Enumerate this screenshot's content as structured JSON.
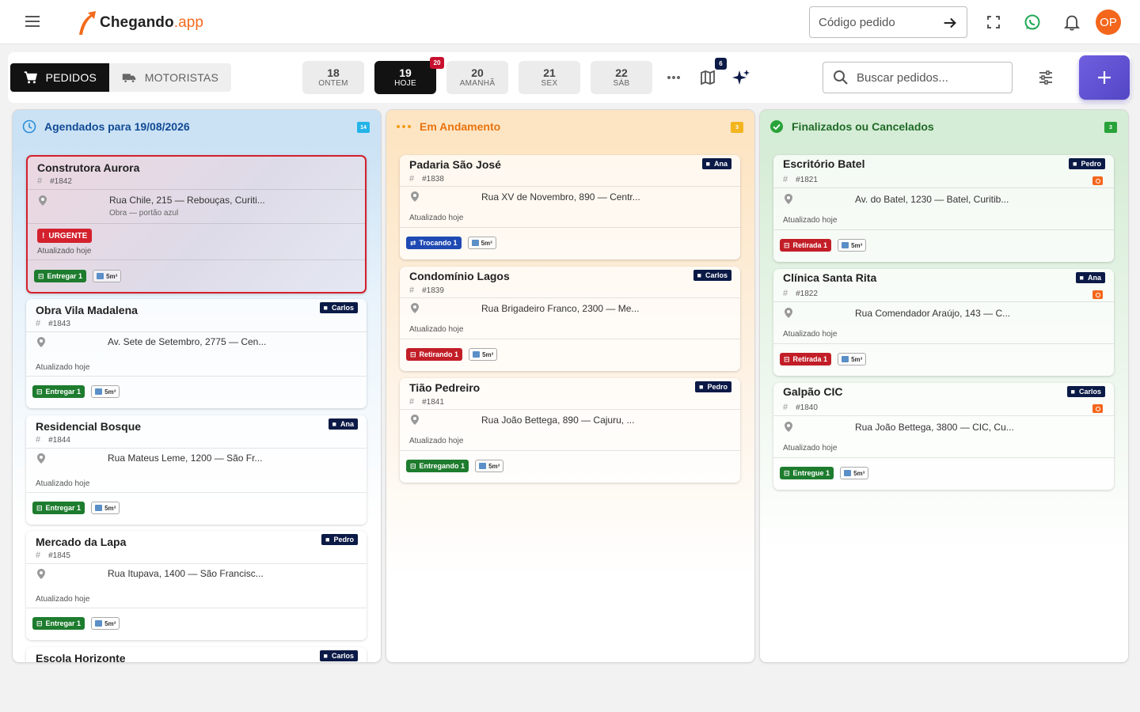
{
  "header": {
    "logo_main": "Chegando",
    "logo_suffix": ".app",
    "code_placeholder": "Código pedido",
    "avatar_initials": "OP"
  },
  "toolbar": {
    "tab_orders": "PEDIDOS",
    "tab_drivers": "MOTORISTAS",
    "dates": [
      {
        "day": "18",
        "label": "ONTEM"
      },
      {
        "day": "19",
        "label": "HOJE",
        "badge": "20"
      },
      {
        "day": "20",
        "label": "AMANHÃ"
      },
      {
        "day": "21",
        "label": "SEX"
      },
      {
        "day": "22",
        "label": "SÁB"
      }
    ],
    "map_badge": "6",
    "search_placeholder": "Buscar pedidos..."
  },
  "colors": {
    "accent": "#f4661b",
    "agendados": "#114a94",
    "andamento": "#e8730f",
    "finalizados": "#1f6b27",
    "driver_badge": "#0b1a46"
  },
  "columns": {
    "agendados": {
      "title": "Agendados para 19/08/2026",
      "count": "14",
      "cards": [
        {
          "title": "Construtora Aurora",
          "code": "#1842",
          "address": "Rua Chile, 215 — Rebouças, Curiti...",
          "note": "Obra — portão azul",
          "urgent_label": "URGENTE",
          "updated": "Atualizado hoje",
          "action": "Entregar 1",
          "size": "5m³"
        },
        {
          "title": "Obra Vila Madalena",
          "code": "#1843",
          "driver": "Carlos",
          "address": "Av. Sete de Setembro, 2775 — Cen...",
          "updated": "Atualizado hoje",
          "action": "Entregar 1",
          "size": "5m³"
        },
        {
          "title": "Residencial Bosque",
          "code": "#1844",
          "driver": "Ana",
          "address": "Rua Mateus Leme, 1200 — São Fr...",
          "updated": "Atualizado hoje",
          "action": "Entregar 1",
          "size": "5m³"
        },
        {
          "title": "Mercado da Lapa",
          "code": "#1845",
          "driver": "Pedro",
          "address": "Rua Itupava, 1400 — São Francisc...",
          "updated": "Atualizado hoje",
          "action": "Entregar 1",
          "size": "5m³"
        },
        {
          "title": "Escola Horizonte",
          "driver": "Carlos"
        }
      ]
    },
    "andamento": {
      "title": "Em Andamento",
      "count": "3",
      "cards": [
        {
          "title": "Padaria São José",
          "code": "#1838",
          "driver": "Ana",
          "address": "Rua XV de Novembro, 890 — Centr...",
          "updated": "Atualizado hoje",
          "action": "Trocando 1",
          "size": "5m³"
        },
        {
          "title": "Condomínio Lagos",
          "code": "#1839",
          "driver": "Carlos",
          "address": "Rua Brigadeiro Franco, 2300 — Me...",
          "updated": "Atualizado hoje",
          "action": "Retirando 1",
          "size": "5m³"
        },
        {
          "title": "Tião Pedreiro",
          "code": "#1841",
          "driver": "Pedro",
          "address": "Rua João Bettega, 890 — Cajuru, ...",
          "updated": "Atualizado hoje",
          "action": "Entregando 1",
          "size": "5m³"
        }
      ]
    },
    "finalizados": {
      "title": "Finalizados ou Cancelados",
      "count": "3",
      "cards": [
        {
          "title": "Escritório Batel",
          "code": "#1821",
          "driver": "Pedro",
          "address": "Av. do Batel, 1230 — Batel, Curitib...",
          "updated": "Atualizado hoje",
          "action": "Retirada 1",
          "size": "5m³"
        },
        {
          "title": "Clínica Santa Rita",
          "code": "#1822",
          "driver": "Ana",
          "address": "Rua Comendador Araújo, 143 — C...",
          "updated": "Atualizado hoje",
          "action": "Retirada 1",
          "size": "5m³"
        },
        {
          "title": "Galpão CIC",
          "code": "#1840",
          "driver": "Carlos",
          "address": "Rua João Bettega, 3800 — CIC, Cu...",
          "updated": "Atualizado hoje",
          "action": "Entregue 1",
          "size": "5m³"
        }
      ]
    }
  }
}
